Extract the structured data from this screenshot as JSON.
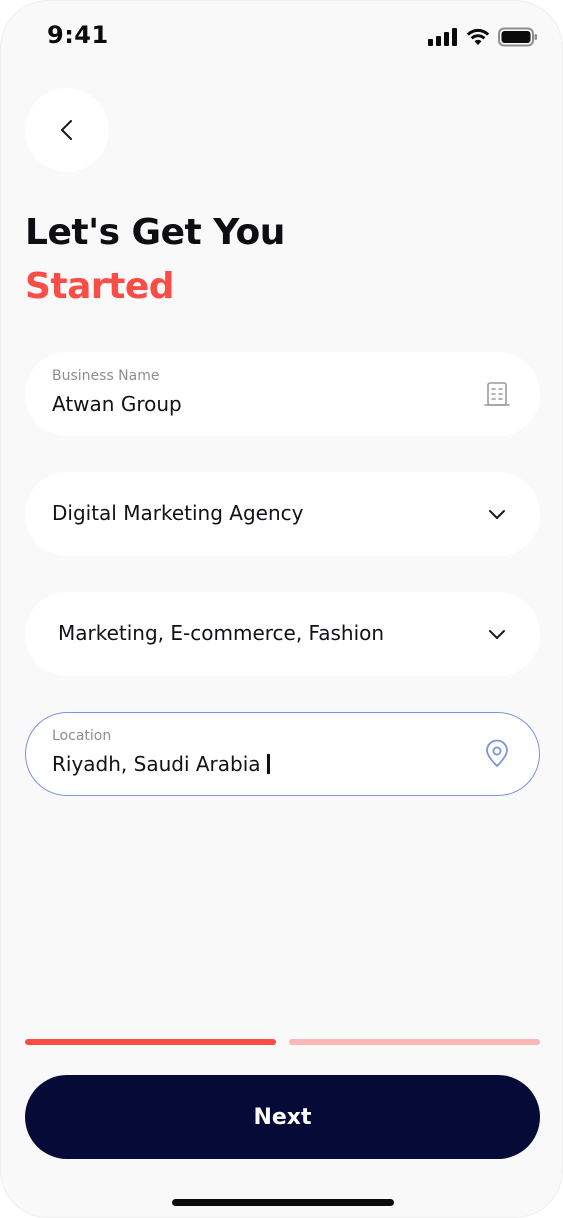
{
  "status_bar": {
    "time": "9:41",
    "icons": [
      "signal-icon",
      "wifi-icon",
      "battery-icon"
    ]
  },
  "header": {
    "back_icon": "chevron-left-icon",
    "title_line1": "Let's Get You",
    "title_line2": "Started"
  },
  "form": {
    "business_name": {
      "label": "Business Name",
      "value": "Atwan Group",
      "icon": "building-icon"
    },
    "business_type": {
      "value": "Digital Marketing Agency",
      "icon": "chevron-down-icon"
    },
    "industries": {
      "value": "Marketing, E-commerce, Fashion",
      "icon": "chevron-down-icon"
    },
    "location": {
      "label": "Location",
      "value": "Riyadh, Saudi Arabia",
      "icon": "location-pin-icon"
    }
  },
  "progress": {
    "steps_total": 2,
    "current_step": 1
  },
  "footer": {
    "next_label": "Next"
  },
  "colors": {
    "accent": "#fa4d45",
    "accent_light": "#fdb5b5",
    "primary_button": "#050b36",
    "focus_border": "#7b93e0",
    "background": "#f9f9f9"
  }
}
